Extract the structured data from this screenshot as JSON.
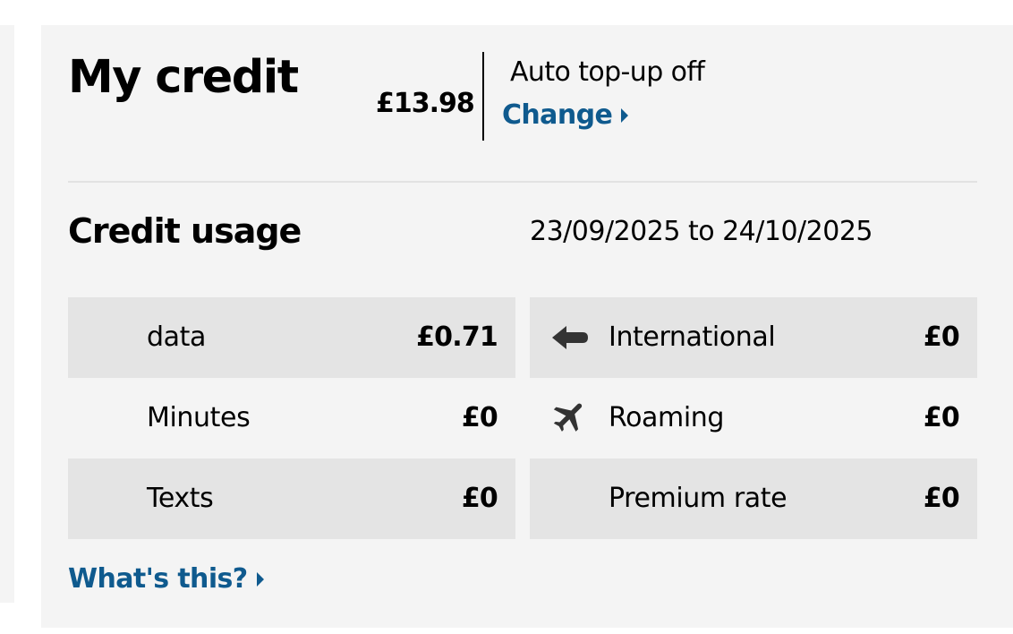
{
  "credit": {
    "title": "My credit",
    "balance": "£13.98",
    "auto_topup_status": "Auto top-up off",
    "change_label": "Change"
  },
  "usage": {
    "title": "Credit usage",
    "period": "23/09/2025 to 24/10/2025",
    "left": [
      {
        "label": "data",
        "value": "£0.71",
        "icon": ""
      },
      {
        "label": "Minutes",
        "value": "£0",
        "icon": ""
      },
      {
        "label": "Texts",
        "value": "£0",
        "icon": ""
      }
    ],
    "right": [
      {
        "label": "International",
        "value": "£0",
        "icon": "arrow-left-icon"
      },
      {
        "label": "Roaming",
        "value": "£0",
        "icon": "airplane-icon"
      },
      {
        "label": "Premium rate",
        "value": "£0",
        "icon": ""
      }
    ],
    "whats_this_label": "What's this?"
  },
  "colors": {
    "link": "#0f5a8e",
    "card_bg": "#f4f4f4",
    "row_shade": "#e4e4e4",
    "icon": "#333333"
  }
}
